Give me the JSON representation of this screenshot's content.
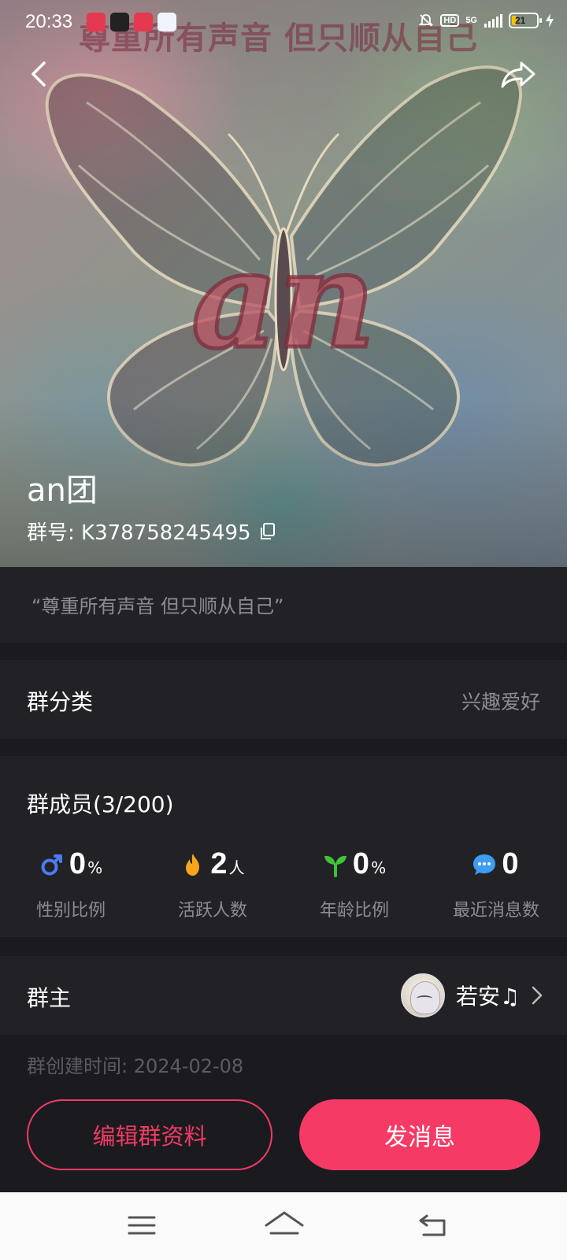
{
  "status_bar": {
    "time": "20:33",
    "apps": [
      "app-icon-1",
      "app-icon-2",
      "app-icon-3",
      "app-icon-4"
    ],
    "network": "5G",
    "hd": "HD",
    "battery_level": "21",
    "battery_fraction": 0.21
  },
  "cover": {
    "watermark_text": "尊重所有声音 但只顺从自己",
    "logo_text": "an"
  },
  "group": {
    "name": "an团",
    "id_label": "群号: K378758245495",
    "announcement": "“尊重所有声音 但只顺从自己”"
  },
  "category": {
    "label": "群分类",
    "value": "兴趣爱好"
  },
  "members": {
    "title": "群成员(3/200)",
    "stats": [
      {
        "icon": "male-icon",
        "value": "0",
        "unit": "%",
        "label": "性别比例"
      },
      {
        "icon": "flame-icon",
        "value": "2",
        "unit": "人",
        "label": "活跃人数"
      },
      {
        "icon": "sprout-icon",
        "value": "0",
        "unit": "%",
        "label": "年龄比例"
      },
      {
        "icon": "chat-bubble-icon",
        "value": "0",
        "unit": "",
        "label": "最近消息数"
      }
    ]
  },
  "owner": {
    "label": "群主",
    "name": "若安♫"
  },
  "created": "群创建时间: 2024-02-08",
  "actions": {
    "edit_label": "编辑群资料",
    "send_label": "发消息"
  },
  "colors": {
    "accent": "#f53a66",
    "background": "#1b1b1f",
    "card": "#222226",
    "muted_text": "#8c8c93",
    "male_blue": "#4a7cf6",
    "flame_orange": "#f6a51c",
    "sprout_green": "#3fc23a",
    "chat_blue": "#3d9cf3"
  }
}
